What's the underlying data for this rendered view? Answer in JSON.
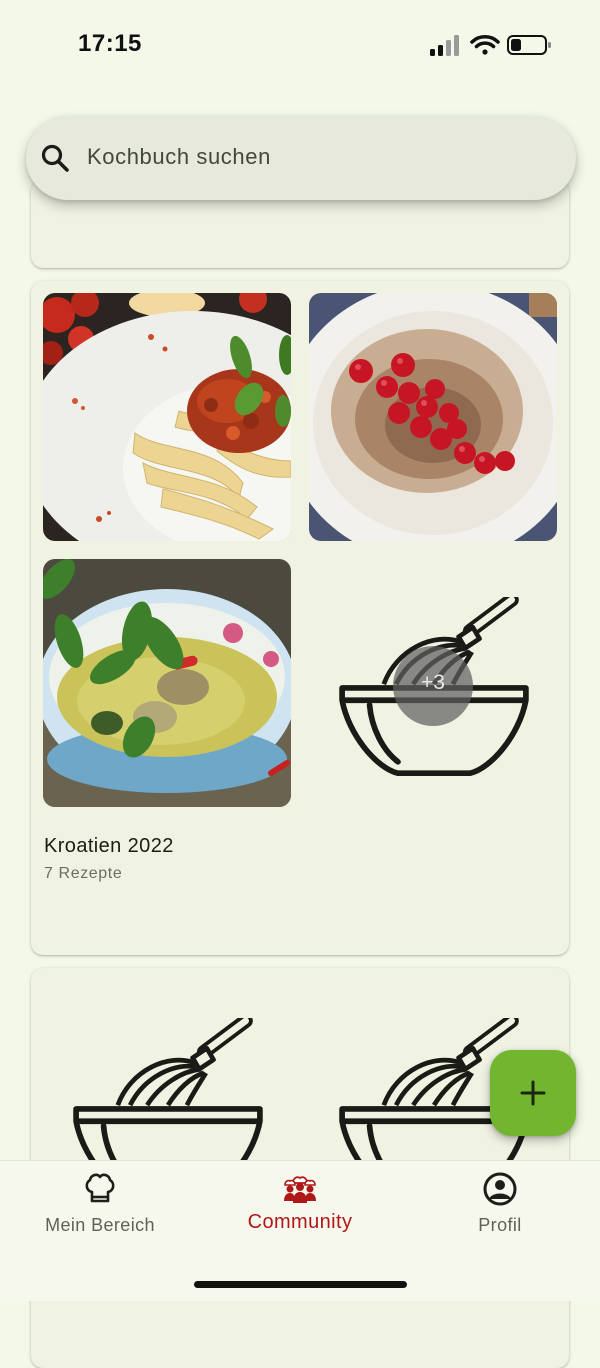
{
  "status_bar": {
    "time": "17:15",
    "icons": [
      "cellular-signal-icon",
      "wifi-icon",
      "battery-icon"
    ]
  },
  "search": {
    "placeholder": "Kochbuch suchen",
    "icon": "search-icon"
  },
  "cookbooks": [
    {
      "title": "Kroatien 2022",
      "count": "7 Rezepte",
      "thumbnails": [
        "pasta-bolognese-photo",
        "rice-pudding-currants-photo",
        "green-curry-photo"
      ],
      "more_badge": "+3",
      "placeholder_icon": "whisk-bowl-icon"
    }
  ],
  "fab": {
    "icon": "plus-icon",
    "color": "#72b52f"
  },
  "bottom_nav": {
    "items": [
      {
        "label": "Mein Bereich",
        "icon": "chef-hat-icon",
        "active": false
      },
      {
        "label": "Community",
        "icon": "community-chefs-icon",
        "active": true
      },
      {
        "label": "Profil",
        "icon": "profile-icon",
        "active": false
      }
    ]
  },
  "colors": {
    "background": "#f3f8e8",
    "card": "#f0f3e2",
    "accent": "#72b52f",
    "active_nav": "#b01818"
  }
}
